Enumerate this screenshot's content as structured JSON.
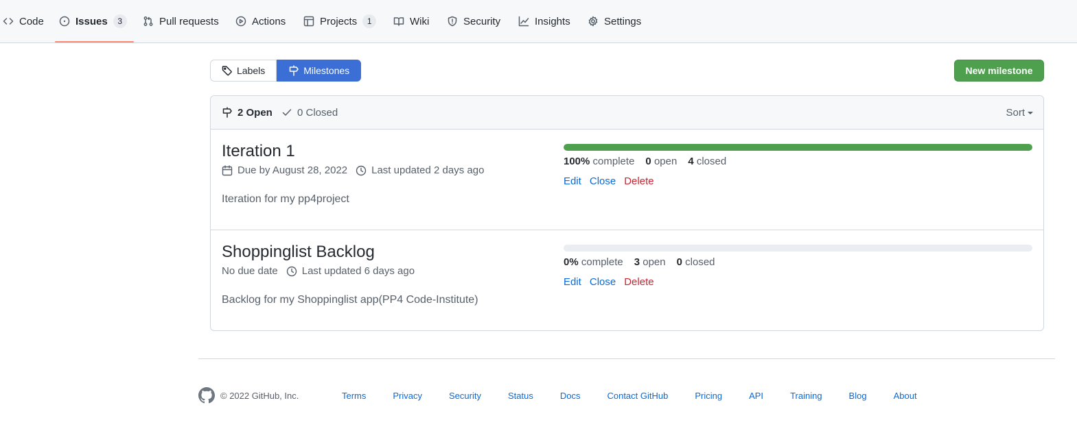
{
  "nav": {
    "items": [
      {
        "label": "Code",
        "icon": "code-icon"
      },
      {
        "label": "Issues",
        "icon": "issue-opened-icon",
        "count": "3"
      },
      {
        "label": "Pull requests",
        "icon": "git-pull-request-icon"
      },
      {
        "label": "Actions",
        "icon": "play-icon"
      },
      {
        "label": "Projects",
        "icon": "table-icon",
        "count": "1"
      },
      {
        "label": "Wiki",
        "icon": "book-icon"
      },
      {
        "label": "Security",
        "icon": "shield-icon"
      },
      {
        "label": "Insights",
        "icon": "graph-icon"
      },
      {
        "label": "Settings",
        "icon": "gear-icon"
      }
    ],
    "selected": "Issues"
  },
  "subnav": {
    "labels": "Labels",
    "milestones": "Milestones"
  },
  "new_milestone": "New milestone",
  "states": {
    "open": "2 Open",
    "closed": "0 Closed"
  },
  "sort": "Sort",
  "milestones": [
    {
      "title": "Iteration 1",
      "due": "Due by August 28, 2022",
      "updated": "Last updated 2 days ago",
      "description": "Iteration for my pp4project",
      "percent": "100%",
      "percent_value": 100,
      "open": "0",
      "closed": "4",
      "complete_label": "complete",
      "open_label": "open",
      "closed_label": "closed"
    },
    {
      "title": "Shoppinglist Backlog",
      "due": "No due date",
      "updated": "Last updated 6 days ago",
      "description": "Backlog for my Shoppinglist app(PP4 Code-Institute)",
      "percent": "0%",
      "percent_value": 0,
      "open": "3",
      "closed": "0",
      "complete_label": "complete",
      "open_label": "open",
      "closed_label": "closed"
    }
  ],
  "actions": {
    "edit": "Edit",
    "close": "Close",
    "delete": "Delete"
  },
  "footer": {
    "copyright": "© 2022 GitHub, Inc.",
    "links": [
      "Terms",
      "Privacy",
      "Security",
      "Status",
      "Docs",
      "Contact GitHub",
      "Pricing",
      "API",
      "Training",
      "Blog",
      "About"
    ]
  },
  "colors": {
    "accent": "#0969da",
    "success": "#4fa04e",
    "danger": "#cf222e",
    "selected_tab": "#3b6fd6",
    "underline": "#fd8c73"
  }
}
